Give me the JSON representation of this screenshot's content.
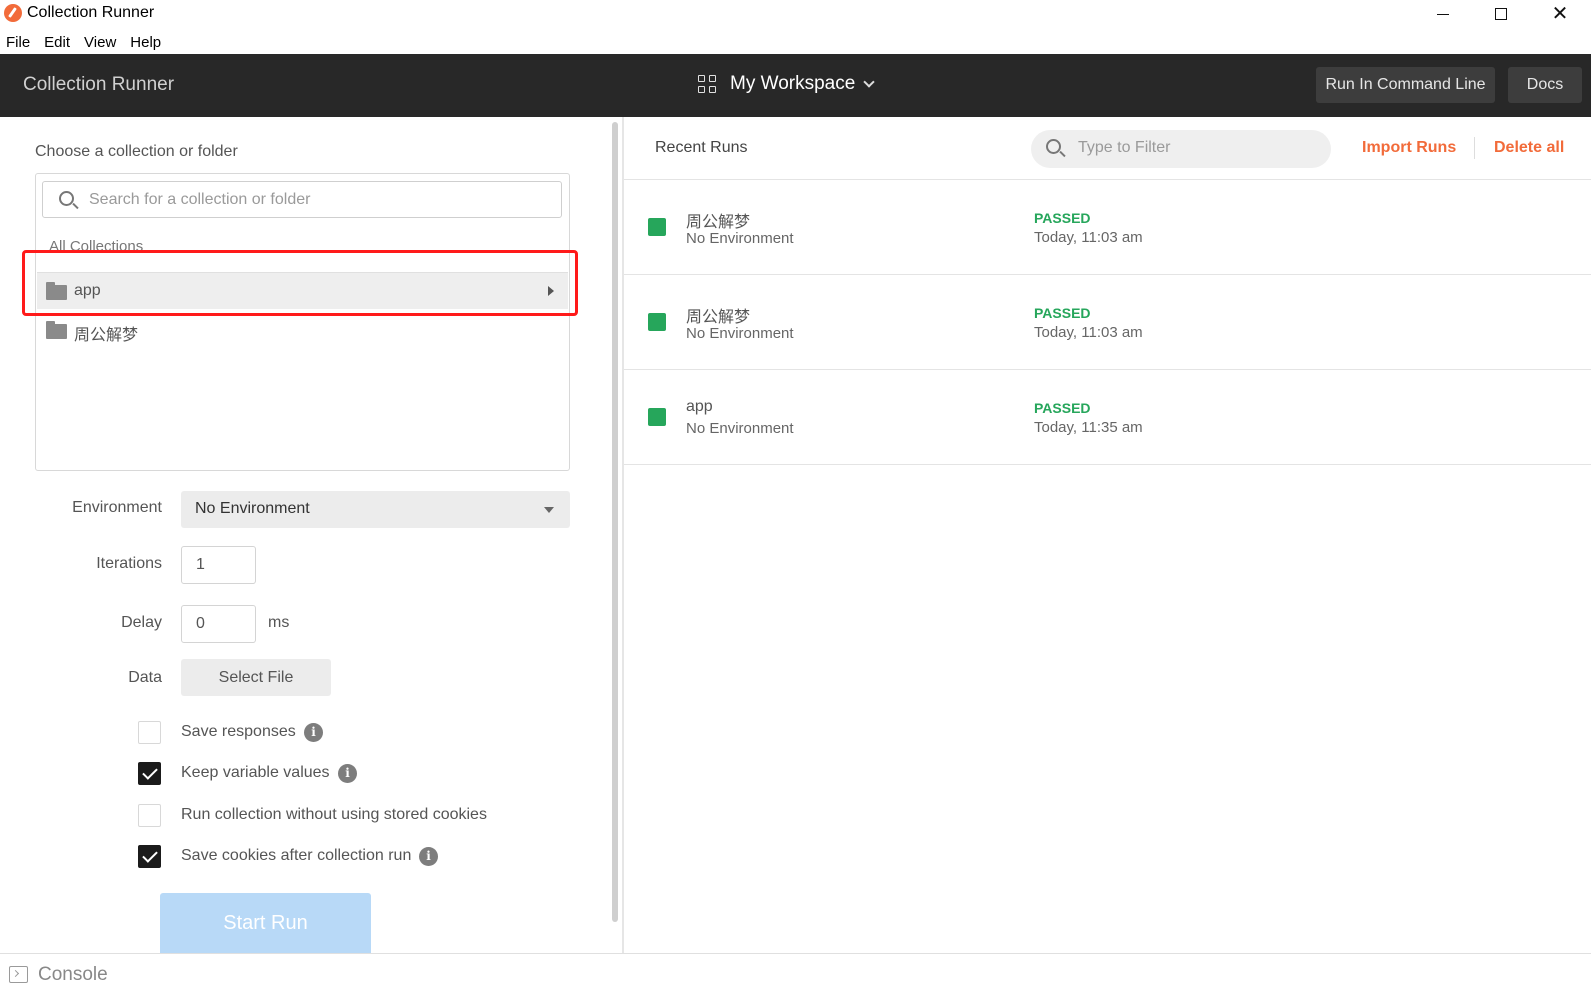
{
  "window": {
    "title": "Collection Runner",
    "minimize_label": "—",
    "close_label": "✕"
  },
  "menu": [
    "File",
    "Edit",
    "View",
    "Help"
  ],
  "header": {
    "brand": "Collection Runner",
    "workspace": "My Workspace",
    "run_cli_label": "Run In Command Line",
    "docs_label": "Docs"
  },
  "left": {
    "choose_label": "Choose a collection or folder",
    "search_placeholder": "Search for a collection or folder",
    "all_collections_label": "All Collections",
    "collections": [
      {
        "name": "app",
        "selected": true
      },
      {
        "name": "周公解梦",
        "selected": false
      }
    ],
    "environment_label": "Environment",
    "environment_value": "No Environment",
    "iterations_label": "Iterations",
    "iterations_value": "1",
    "delay_label": "Delay",
    "delay_value": "0",
    "delay_unit": "ms",
    "data_label": "Data",
    "select_file_label": "Select File",
    "options": [
      {
        "label": "Save responses",
        "checked": false,
        "info": true
      },
      {
        "label": "Keep variable values",
        "checked": true,
        "info": true
      },
      {
        "label": "Run collection without using stored cookies",
        "checked": false,
        "info": false
      },
      {
        "label": "Save cookies after collection run",
        "checked": true,
        "info": true
      }
    ],
    "start_run_label": "Start Run",
    "info_glyph": "i"
  },
  "right": {
    "recent_runs_label": "Recent Runs",
    "filter_placeholder": "Type to Filter",
    "import_runs_label": "Import Runs",
    "delete_all_label": "Delete all",
    "runs": [
      {
        "name": "周公解梦",
        "environment": "No Environment",
        "status": "PASSED",
        "time": "Today, 11:03 am"
      },
      {
        "name": "周公解梦",
        "environment": "No Environment",
        "status": "PASSED",
        "time": "Today, 11:03 am"
      },
      {
        "name": "app",
        "environment": "No Environment",
        "status": "PASSED",
        "time": "Today, 11:35 am"
      }
    ]
  },
  "footer": {
    "console_label": "Console"
  },
  "colors": {
    "accent": "#f26b3a",
    "passed": "#26a65b",
    "header_bg": "#282828",
    "highlight": "#ff1a1a",
    "start_run_bg": "#b8d9f7"
  },
  "icons": {
    "app": "postman-logo-icon",
    "workspace": "grid-icon",
    "search": "search-icon",
    "folder": "folder-icon",
    "console": "console-icon"
  }
}
